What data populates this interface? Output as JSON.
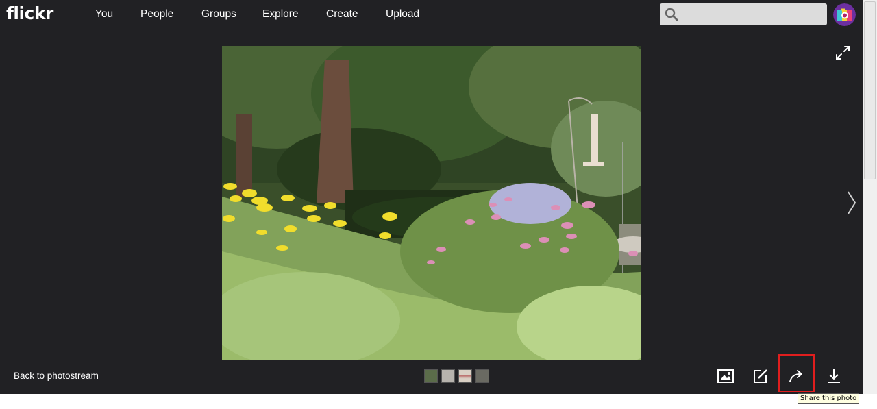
{
  "header": {
    "logo": "flickr",
    "nav": [
      {
        "label": "You"
      },
      {
        "label": "People"
      },
      {
        "label": "Groups"
      },
      {
        "label": "Explore"
      },
      {
        "label": "Create"
      },
      {
        "label": "Upload"
      }
    ],
    "search": {
      "placeholder": "",
      "value": "",
      "icon": "search-icon"
    },
    "avatar": {
      "icon": "camera-avatar-icon"
    }
  },
  "viewer": {
    "photo_subject": "garden with coneflowers, yarrow and trees",
    "expand_icon": "expand-icon",
    "next_icon": "chevron-right-icon"
  },
  "footer": {
    "back_label": "Back to photostream",
    "thumbnails": 4,
    "tools": [
      {
        "icon": "image-icon"
      },
      {
        "icon": "edit-icon"
      },
      {
        "icon": "share-icon"
      },
      {
        "icon": "download-icon"
      }
    ],
    "tooltip": "Share this photo"
  },
  "colors": {
    "background": "#212124",
    "highlight": "#e01e1e",
    "tooltip_bg": "#ffffe1"
  }
}
